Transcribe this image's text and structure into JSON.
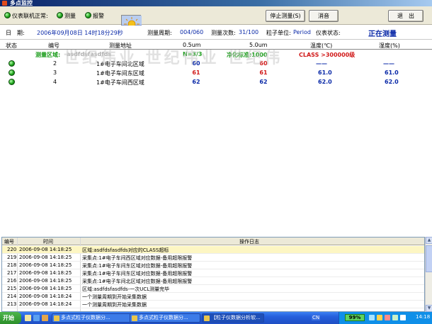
{
  "window": {
    "title": "多点监控"
  },
  "toolbar": {
    "status_instrument": "仪表联机正常:",
    "status_measure": "测量",
    "status_alarm": "报警",
    "stop_button": "停止测量(S)",
    "mute_button": "消音",
    "exit_button": "退　出"
  },
  "info": {
    "date_label": "日　期:",
    "date_value": "2006年09月08日 14时18分29秒",
    "period_label": "测量周期:",
    "period_value": "004/060",
    "count_label": "测量次数:",
    "count_value": "31/100",
    "unit_label": "粒子单位:",
    "unit_value": "Period",
    "status_label": "仪表状态:",
    "status_value": "正在测量"
  },
  "table": {
    "headers": [
      "状态",
      "编号",
      "测量地址",
      "0.5um",
      "5.0um",
      "温度(℃)",
      "湿度(%)"
    ],
    "zone_label": "测量区域:",
    "zone_value": "asdfdsfasdfds",
    "n_value": "N=3/3",
    "standard": "净化标准:1000",
    "class_value": "CLASS >300000级",
    "rows": [
      {
        "no": "2",
        "address": "1#电子车间北区域",
        "v05": "60",
        "v50": "60",
        "temp": "——",
        "hum": "——"
      },
      {
        "no": "3",
        "address": "1#电子车间东区域",
        "v05": "61",
        "v50": "61",
        "temp": "61.0",
        "hum": "61.0"
      },
      {
        "no": "4",
        "address": "1#电子车间西区域",
        "v05": "62",
        "v50": "62",
        "temp": "62.0",
        "hum": "62.0"
      }
    ]
  },
  "watermark": "世纪伟业  世纪伟业  世纪伟",
  "log": {
    "headers": [
      "编号",
      "时间",
      "操作日志"
    ],
    "rows": [
      {
        "no": "220",
        "time": "2006-09-08 14:18:25",
        "msg": "区域:asdfdsfasdfds对应的CLASS超标"
      },
      {
        "no": "219",
        "time": "2006-09-08 14:18:25",
        "msg": "采集点:1#电子车间西区域对应数据-备用超限报警"
      },
      {
        "no": "218",
        "time": "2006-09-08 14:18:25",
        "msg": "采集点:1#电子车间东区域对应数据-备用超限报警"
      },
      {
        "no": "217",
        "time": "2006-09-08 14:18:25",
        "msg": "采集点:1#电子车间东区域对应数据-备用超限报警"
      },
      {
        "no": "216",
        "time": "2006-09-08 14:18:25",
        "msg": "采集点:1#电子车间北区域对应数据-备用超限报警"
      },
      {
        "no": "215",
        "time": "2006-09-08 14:18:25",
        "msg": "区域:asdfdsfasdfds-一次UCL测量完毕"
      },
      {
        "no": "214",
        "time": "2006-09-08 14:18:24",
        "msg": "一个测量周期到开始采集数据"
      },
      {
        "no": "213",
        "time": "2006-09-08 14:18:24",
        "msg": "一个测量周期到开始采集数据"
      }
    ]
  },
  "taskbar": {
    "start": "开始",
    "tasks": [
      "多点式粒子仪数据分...",
      "多点式粒子仪数据分...",
      "【粒子仪数据分析软..."
    ],
    "battery": "99%",
    "time": "14:18",
    "lang": "CN"
  },
  "colors": {
    "led_green": "#1fa51c",
    "accent_blue": "#0b2aa8",
    "alarm_red": "#d11a1a",
    "zone_green": "#1f9e1f"
  }
}
